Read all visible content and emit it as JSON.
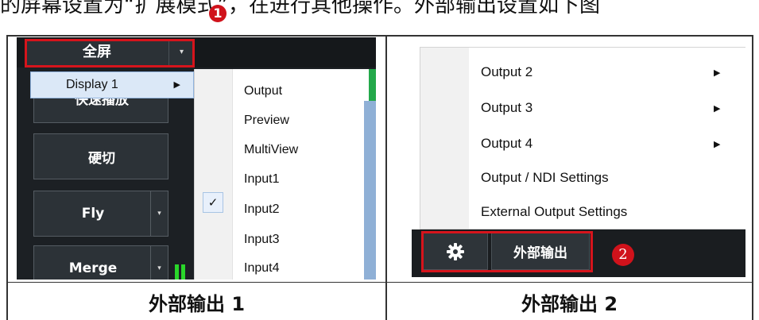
{
  "top_caption": "的屏幕设置为“扩展模式”，在进行其他操作。外部输出设置如下图",
  "badge1": "1",
  "panel1": {
    "fullscreen_label": "全屏",
    "fullscreen_arrow": "▾",
    "display_item": {
      "label": "Display 1",
      "arrow": "▶"
    },
    "submenu_items": [
      "Output",
      "Preview",
      "MultiView",
      "Input1",
      "Input2",
      "Input3",
      "Input4"
    ],
    "checked_item": "Input2",
    "check_glyph": "✓",
    "buttons": [
      {
        "label": "快速播放",
        "has_split": false
      },
      {
        "label": "硬切",
        "has_split": false
      },
      {
        "label": "Fly",
        "has_split": true,
        "split_glyph": "▾"
      },
      {
        "label": "Merge",
        "has_split": true,
        "split_glyph": "▾"
      }
    ]
  },
  "panel2": {
    "items": [
      {
        "label": "Output 2",
        "arrow": "▶"
      },
      {
        "label": "Output 3",
        "arrow": "▶"
      },
      {
        "label": "Output 4",
        "arrow": "▶"
      },
      {
        "label": "Output / NDI Settings",
        "arrow": ""
      },
      {
        "label": "External Output Settings",
        "arrow": ""
      }
    ],
    "gear_icon": "gear-icon",
    "external_output_label": "外部输出",
    "badge2": "2"
  },
  "captions": [
    "外部输出 1",
    "外部输出 2"
  ],
  "colors": {
    "highlight_red": "#d6141c",
    "badge_red": "#d0121b",
    "dark_bg": "#1c2024",
    "menu_highlight": "#dbe8f7",
    "meter_green": "#2ad62a"
  }
}
